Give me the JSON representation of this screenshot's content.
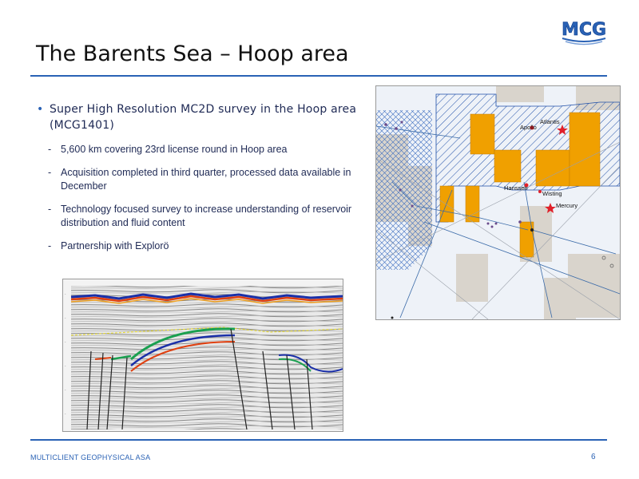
{
  "logo": {
    "text": "MCG"
  },
  "title": "The Barents Sea – Hoop area",
  "bullets": {
    "main": "Super High Resolution MC2D survey in the Hoop area (MCG1401)",
    "sub": [
      "5,600 km covering 23rd license round in Hoop area",
      "Acquisition completed in third quarter, processed data available in December",
      "Technology focused survey to increase understanding of reservoir distribution and fluid content",
      "Partnership with Explorö"
    ]
  },
  "map": {
    "labels": {
      "atlantis": "Atlantis",
      "apollo": "Apollo",
      "hanssen": "Hanssen",
      "wisting": "Wisting",
      "mercury": "Mercury"
    },
    "colors": {
      "block": "#f0a000",
      "hatch": "#1f4fa8",
      "star": "#e0202a",
      "land": "#d9d4cc"
    }
  },
  "footer": {
    "company": "MULTICLIENT GEOPHYSICAL ASA",
    "page": "6"
  }
}
